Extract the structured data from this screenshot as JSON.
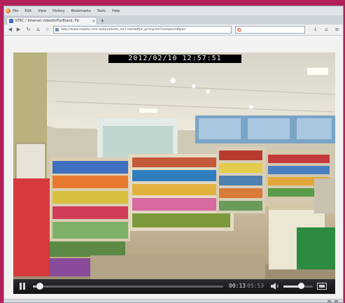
{
  "browser": {
    "menu": [
      "File",
      "Edit",
      "View",
      "History",
      "Bookmarks",
      "Tools",
      "Help"
    ],
    "tab": {
      "title": "KTEC / Internet videoforForBland, Pb"
    },
    "url": "http://www.veeptu.com.aut/products_en/i.net/ledfps_privny.hmi?ssmptsi/dfplan",
    "search_engine_letter": "G",
    "new_tab_symbol": "+"
  },
  "icons": {
    "app": "browser-logo-icon",
    "back": "back-arrow-icon",
    "forward": "forward-arrow-icon",
    "reload": "reload-icon",
    "home": "home-icon",
    "pause": "pause-icon",
    "volume": "speaker-icon",
    "fullscreen": "fullscreen-icon"
  },
  "video": {
    "overlay_timestamp": "2012/02/10  12:57:51",
    "current_time": "00:13",
    "total_time": "05:53",
    "progress": 0.037,
    "volume": 0.6
  },
  "colors": {
    "page_background": "#b2205a",
    "player_background": "#111111",
    "controls_background": "#1c1d20"
  }
}
